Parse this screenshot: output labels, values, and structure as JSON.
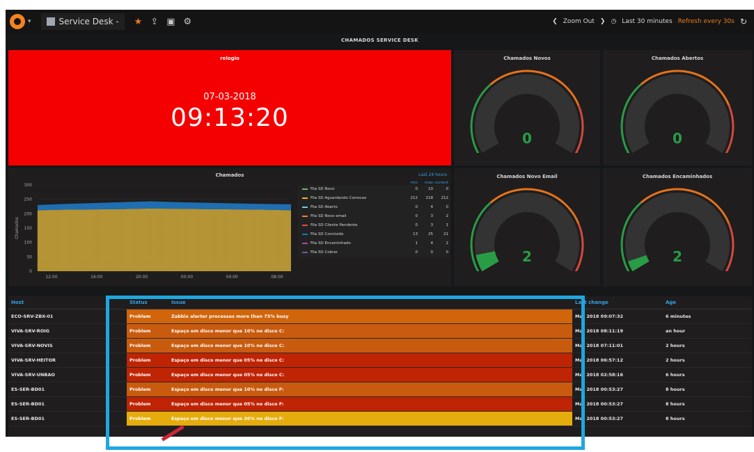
{
  "topbar": {
    "dashboard_name": "Service Desk -",
    "zoom_out": "Zoom Out",
    "time_range": "Last 30 minutes",
    "refresh": "Refresh every 30s"
  },
  "icons": {
    "logo": "grafana-logo-icon",
    "star": "star-icon",
    "share": "share-icon",
    "save": "save-icon",
    "settings": "gear-icon",
    "refresh": "refresh-icon"
  },
  "row_title": "CHAMADOS SERVICE DESK",
  "clock": {
    "title": "relogio",
    "date": "07-03-2018",
    "time": "09:13:20"
  },
  "gauges": [
    {
      "title": "Chamados Novos",
      "value": "0",
      "fraction": 0
    },
    {
      "title": "Chamados Abertos",
      "value": "0",
      "fraction": 0
    },
    {
      "title": "Chamados Novo Email",
      "value": "2",
      "fraction": 0.08
    },
    {
      "title": "Chamados Encaminhados",
      "value": "2",
      "fraction": 0.05
    }
  ],
  "chamados_panel": {
    "title": "Chamados",
    "range": "Last 24 hours",
    "legend_headers": [
      "min",
      "max",
      "current"
    ],
    "legend": [
      {
        "name": "Fila SD Novo",
        "color": "#7eb26d",
        "min": "0",
        "max": "10",
        "current": "0"
      },
      {
        "name": "Fila SD Aguardando Correcao",
        "color": "#eab839",
        "min": "212",
        "max": "218",
        "current": "212"
      },
      {
        "name": "Fila SD Aberto",
        "color": "#6ed0e0",
        "min": "0",
        "max": "4",
        "current": "0"
      },
      {
        "name": "Fila SD Novo email",
        "color": "#ef843c",
        "min": "0",
        "max": "3",
        "current": "2"
      },
      {
        "name": "Fila SD Cliente Pendente",
        "color": "#e24d42",
        "min": "0",
        "max": "3",
        "current": "1"
      },
      {
        "name": "Fila SD Concluido",
        "color": "#1f78c1",
        "min": "13",
        "max": "25",
        "current": "21"
      },
      {
        "name": "Fila SD Encaminhado",
        "color": "#ba43a9",
        "min": "1",
        "max": "4",
        "current": "2"
      },
      {
        "name": "Fila SD Cobrar",
        "color": "#705da0",
        "min": "0",
        "max": "0",
        "current": "0"
      }
    ]
  },
  "chart_data": {
    "type": "area",
    "title": "Chamados",
    "ylabel": "Chamados",
    "xlabel": "",
    "ylim": [
      0,
      300
    ],
    "y_ticks": [
      "300",
      "250",
      "200",
      "150",
      "100",
      "50",
      "0"
    ],
    "x_ticks": [
      "12:00",
      "16:00",
      "20:00",
      "00:00",
      "04:00",
      "08:00"
    ],
    "series": [
      {
        "name": "Fila SD Aguardando Correcao",
        "values": [
          212,
          214,
          215,
          216,
          218,
          217,
          216,
          215,
          214,
          212
        ]
      },
      {
        "name": "Fila SD Concluido",
        "values": [
          18,
          20,
          22,
          24,
          25,
          23,
          22,
          21,
          20,
          21
        ]
      }
    ]
  },
  "table": {
    "headers": [
      "Host",
      "Status",
      "Issue",
      "Last change",
      "Age"
    ],
    "rows": [
      {
        "host": "ECO-SRV-ZBX-01",
        "status": "Problem",
        "issue": "Zabbix alerter processes more than 75% busy",
        "last_change": "Mar 2018 09:07:32",
        "age": "6 minutes",
        "color": "#d1650c"
      },
      {
        "host": "VIVA-SRV-ROIG",
        "status": "Problem",
        "issue": "Espaço em disco menor que 10% no disco C:",
        "last_change": "Mar 2018 08:11:19",
        "age": "an hour",
        "color": "#c95b0f"
      },
      {
        "host": "VIVA-SRV-NOVIS",
        "status": "Problem",
        "issue": "Espaço em disco menor que 10% no disco C:",
        "last_change": "Mar 2018 07:11:01",
        "age": "2 hours",
        "color": "#c95b0f"
      },
      {
        "host": "VIVA-SRV-HEITOR",
        "status": "Problem",
        "issue": "Espaço em disco menor que 05% no disco C:",
        "last_change": "Mar 2018 06:57:12",
        "age": "2 hours",
        "color": "#bf2405"
      },
      {
        "host": "VIVA-SRV-UNBAO",
        "status": "Problem",
        "issue": "Espaço em disco menor que 05% no disco C:",
        "last_change": "Mar 2018 02:58:16",
        "age": "6 hours",
        "color": "#bf2405"
      },
      {
        "host": "ES-SER-BD01",
        "status": "Problem",
        "issue": "Espaço em disco menor que 10% no disco F:",
        "last_change": "Mar 2018 00:53:27",
        "age": "8 hours",
        "color": "#c95b0f"
      },
      {
        "host": "ES-SER-BD01",
        "status": "Problem",
        "issue": "Espaço em disco menor que 05% no disco F:",
        "last_change": "Mar 2018 00:53:27",
        "age": "8 hours",
        "color": "#bf2405"
      },
      {
        "host": "ES-SER-BD01",
        "status": "Problem",
        "issue": "Espaço em disco menor que 20% no disco F:",
        "last_change": "Mar 2018 00:53:27",
        "age": "8 hours",
        "color": "#e5ac0e"
      }
    ]
  }
}
